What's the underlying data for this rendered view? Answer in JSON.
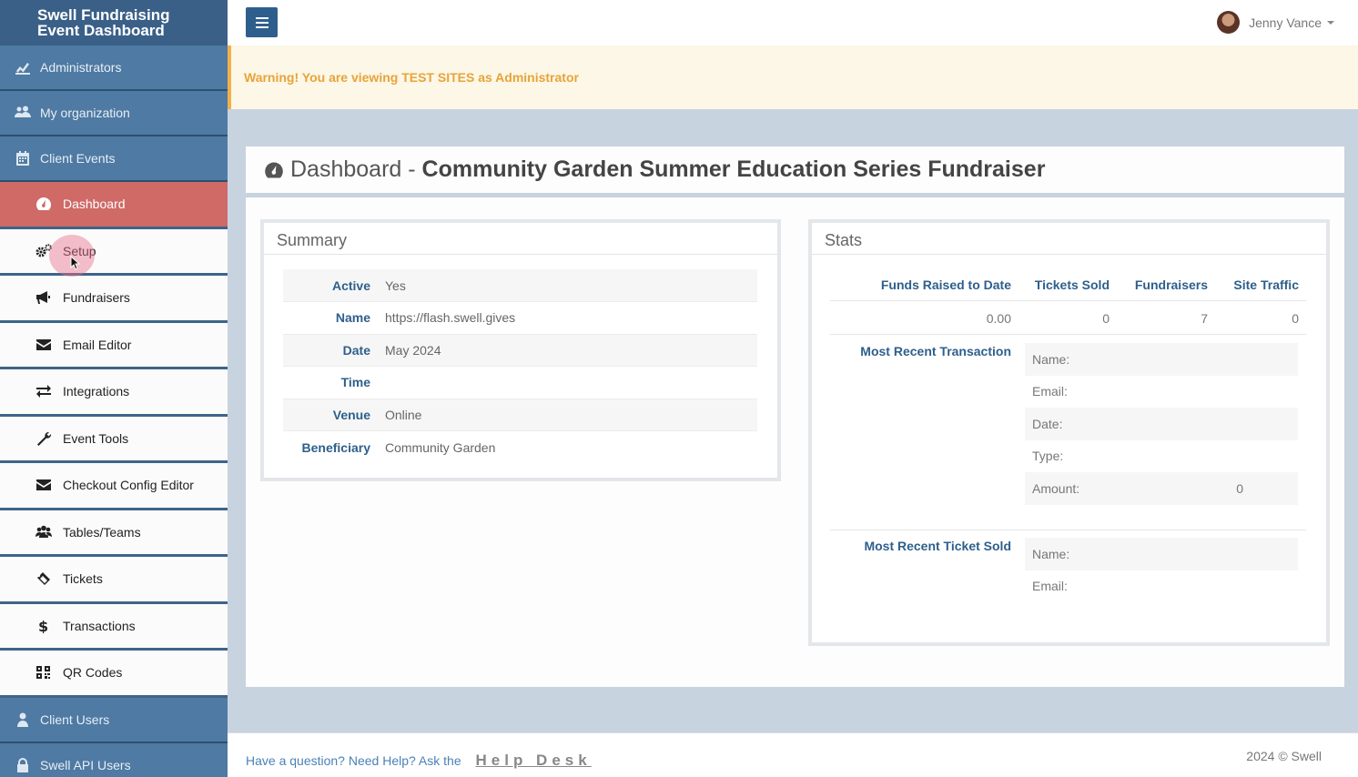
{
  "app": {
    "title_line1": "Swell Fundraising",
    "title_line2": "Event Dashboard"
  },
  "sidebar": {
    "top_items": [
      {
        "label": "Administrators",
        "icon": "chart-line-icon"
      },
      {
        "label": "My organization",
        "icon": "users-icon"
      },
      {
        "label": "Client Events",
        "icon": "calendar-icon"
      }
    ],
    "sub_items": [
      {
        "label": "Dashboard",
        "icon": "dashboard-icon",
        "active": true
      },
      {
        "label": "Setup",
        "icon": "gears-icon"
      },
      {
        "label": "Fundraisers",
        "icon": "bullhorn-icon"
      },
      {
        "label": "Email Editor",
        "icon": "envelope-icon"
      },
      {
        "label": "Integrations",
        "icon": "exchange-icon"
      },
      {
        "label": "Event Tools",
        "icon": "wrench-icon"
      },
      {
        "label": "Checkout Config Editor",
        "icon": "envelope-icon"
      },
      {
        "label": "Tables/Teams",
        "icon": "users-icon"
      },
      {
        "label": "Tickets",
        "icon": "ticket-icon"
      },
      {
        "label": "Transactions",
        "icon": "dollar-icon"
      },
      {
        "label": "QR Codes",
        "icon": "qrcode-icon"
      }
    ],
    "bottom_items": [
      {
        "label": "Client Users",
        "icon": "user-icon"
      },
      {
        "label": "Swell API Users",
        "icon": "lock-icon"
      }
    ],
    "active_color": "#cf6a67"
  },
  "topbar": {
    "user_name": "Jenny Vance"
  },
  "warning": {
    "text": "Warning! You are viewing TEST SITES as Administrator"
  },
  "page": {
    "title_prefix": "Dashboard - ",
    "event_name": "Community Garden Summer Education Series Fundraiser"
  },
  "summary": {
    "title": "Summary",
    "rows": [
      {
        "key": "Active",
        "value": "Yes"
      },
      {
        "key": "Name",
        "value": "https://flash.swell.gives"
      },
      {
        "key": "Date",
        "value": "May 2024"
      },
      {
        "key": "Time",
        "value": ""
      },
      {
        "key": "Venue",
        "value": "Online"
      },
      {
        "key": "Beneficiary",
        "value": "Community Garden"
      }
    ]
  },
  "stats": {
    "title": "Stats",
    "headers": [
      "Funds Raised to Date",
      "Tickets Sold",
      "Fundraisers",
      "Site Traffic"
    ],
    "values": [
      "0.00",
      "0",
      "7",
      "0"
    ],
    "recent_transaction": {
      "label": "Most Recent Transaction",
      "fields": [
        {
          "key": "Name:",
          "value": ""
        },
        {
          "key": "Email:",
          "value": ""
        },
        {
          "key": "Date:",
          "value": ""
        },
        {
          "key": "Type:",
          "value": ""
        },
        {
          "key": "Amount:",
          "value": "0"
        }
      ]
    },
    "recent_ticket": {
      "label": "Most Recent Ticket Sold",
      "fields": [
        {
          "key": "Name:",
          "value": ""
        },
        {
          "key": "Email:",
          "value": ""
        }
      ]
    }
  },
  "footer": {
    "help_text": "Have a question? Need Help? Ask the",
    "help_link": "Help Desk",
    "copyright": "2024 © Swell"
  }
}
